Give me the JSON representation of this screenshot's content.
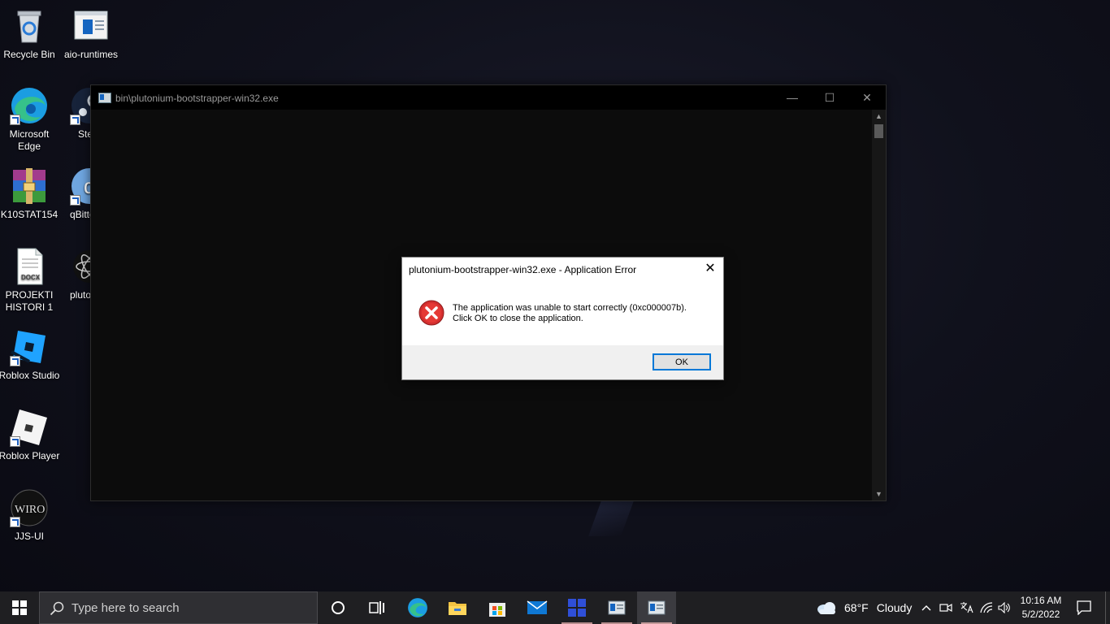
{
  "desktop": {
    "icons": [
      {
        "label": "Recycle Bin",
        "icon": "recycle-bin-icon"
      },
      {
        "label": "aio-runtimes",
        "icon": "installer-icon"
      },
      {
        "label": "Microsoft Edge",
        "icon": "edge-icon"
      },
      {
        "label": "Ste",
        "icon": "steam-icon"
      },
      {
        "label": "K10STAT154",
        "icon": "winrar-icon"
      },
      {
        "label": "qBitto",
        "icon": "qbittorrent-icon"
      },
      {
        "label": "PROJEKTI HISTORI 1",
        "icon": "docx-icon",
        "badge": "DOCX"
      },
      {
        "label": "pluto",
        "icon": "plutonium-icon"
      },
      {
        "label": "Roblox Studio",
        "icon": "roblox-studio-icon"
      },
      {
        "label": "Roblox Player",
        "icon": "roblox-player-icon"
      },
      {
        "label": "JJS-UI",
        "icon": "jjs-ui-icon",
        "badge": "WIRO"
      }
    ]
  },
  "console": {
    "title": "bin\\plutonium-bootstrapper-win32.exe",
    "minimize": "—",
    "maximize": "☐",
    "close": "✕",
    "scroll_up": "▲",
    "scroll_down": "▼"
  },
  "dialog": {
    "title": "plutonium-bootstrapper-win32.exe - Application Error",
    "close": "✕",
    "line1": "The application was unable to start correctly (0xc000007b).",
    "line2": "Click OK to close the application.",
    "ok": "OK"
  },
  "taskbar": {
    "search_placeholder": "Type here to search",
    "weather_temp": "68°F",
    "weather_desc": "Cloudy",
    "time": "10:16 AM",
    "date": "5/2/2022",
    "tray_chevron": "^"
  },
  "colors": {
    "accent": "#0078d7",
    "error_red": "#d32f2f",
    "taskbar": "#1f1f22"
  }
}
